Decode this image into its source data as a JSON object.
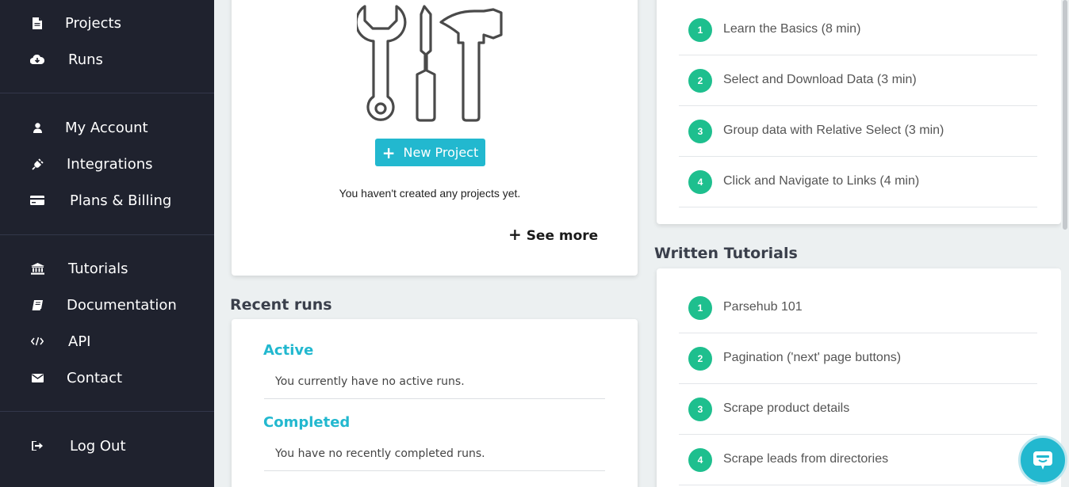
{
  "sidebar": {
    "items": [
      {
        "label": "Projects",
        "icon": "file-icon"
      },
      {
        "label": "Runs",
        "icon": "cloud-download-icon"
      },
      {
        "label": "My Account",
        "icon": "user-icon"
      },
      {
        "label": "Integrations",
        "icon": "plug-icon"
      },
      {
        "label": "Plans & Billing",
        "icon": "credit-card-icon"
      },
      {
        "label": "Tutorials",
        "icon": "bank-icon"
      },
      {
        "label": "Documentation",
        "icon": "book-icon"
      },
      {
        "label": "API",
        "icon": "code-icon"
      },
      {
        "label": "Contact",
        "icon": "envelope-icon"
      },
      {
        "label": "Log Out",
        "icon": "sign-out-icon"
      }
    ]
  },
  "projects": {
    "new_project_label": "New Project",
    "empty_message": "You haven't created any projects yet.",
    "see_more_label": "See more"
  },
  "recent_runs": {
    "title": "Recent runs",
    "active_heading": "Active",
    "active_message": "You currently have no active runs.",
    "completed_heading": "Completed",
    "completed_message": "You have no recently completed runs."
  },
  "video_tutorials": {
    "items": [
      {
        "num": "1",
        "label": "Learn the Basics (8 min)"
      },
      {
        "num": "2",
        "label": "Select and Download Data (3 min)"
      },
      {
        "num": "3",
        "label": "Group data with Relative Select (3 min)"
      },
      {
        "num": "4",
        "label": "Click and Navigate to Links (4 min)"
      }
    ]
  },
  "written_tutorials": {
    "title": "Written Tutorials",
    "items": [
      {
        "num": "1",
        "label": "Parsehub 101"
      },
      {
        "num": "2",
        "label": "Pagination ('next' page buttons)"
      },
      {
        "num": "3",
        "label": "Scrape product details"
      },
      {
        "num": "4",
        "label": "Scrape leads from directories"
      }
    ]
  },
  "colors": {
    "sidebar_bg": "#1f222e",
    "accent": "#22b8cf",
    "tutorial_badge": "#1ebf8e"
  }
}
